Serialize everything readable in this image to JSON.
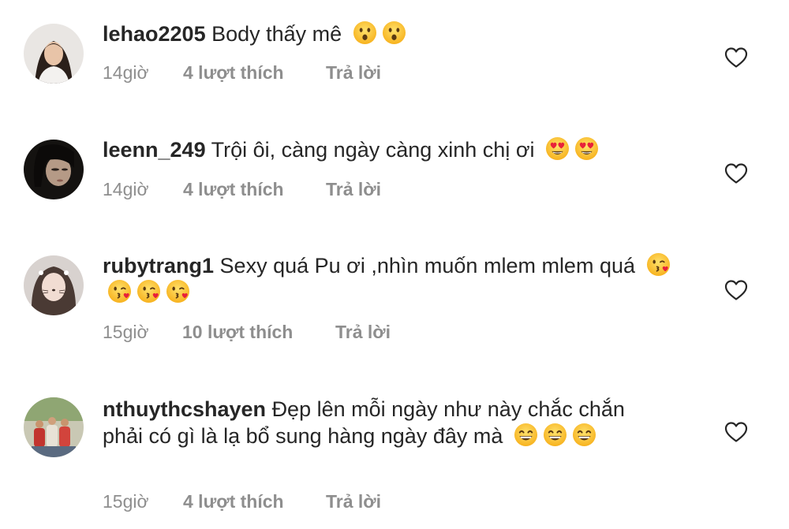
{
  "comments": [
    {
      "username": "lehao2205",
      "text": "Body thấy mê",
      "emojis": [
        "hushed-face-emoji",
        "hushed-face-emoji"
      ],
      "time": "14giờ",
      "likes": "4 lượt thích",
      "reply": "Trả lời"
    },
    {
      "username": "leenn_249",
      "text": "Trội ôi, càng ngày càng xinh chị ơi",
      "emojis": [
        "heart-eyes-emoji",
        "heart-eyes-emoji"
      ],
      "time": "14giờ",
      "likes": "4 lượt thích",
      "reply": "Trả lời"
    },
    {
      "username": "rubytrang1",
      "text": "Sexy quá Pu ơi ,nhìn muốn mlem mlem quá",
      "emojis": [
        "kissing-heart-emoji",
        "kissing-heart-emoji",
        "kissing-heart-emoji",
        "kissing-heart-emoji"
      ],
      "time": "15giờ",
      "likes": "10 lượt thích",
      "reply": "Trả lời"
    },
    {
      "username": "nthuythcshayen",
      "text": "Đẹp lên mỗi ngày như này chắc chắn phải có gì là lạ bổ sung hàng ngày đây mà",
      "emojis": [
        "grinning-face-emoji",
        "grinning-face-emoji",
        "grinning-face-emoji"
      ],
      "time": "15giờ",
      "likes": "4 lượt thích",
      "reply": "Trả lời"
    }
  ],
  "icons": {
    "like": "heart-outline-icon",
    "avatar": "profile-photo"
  },
  "colors": {
    "text": "#262626",
    "secondary": "#8e8e8e",
    "background": "#ffffff"
  }
}
